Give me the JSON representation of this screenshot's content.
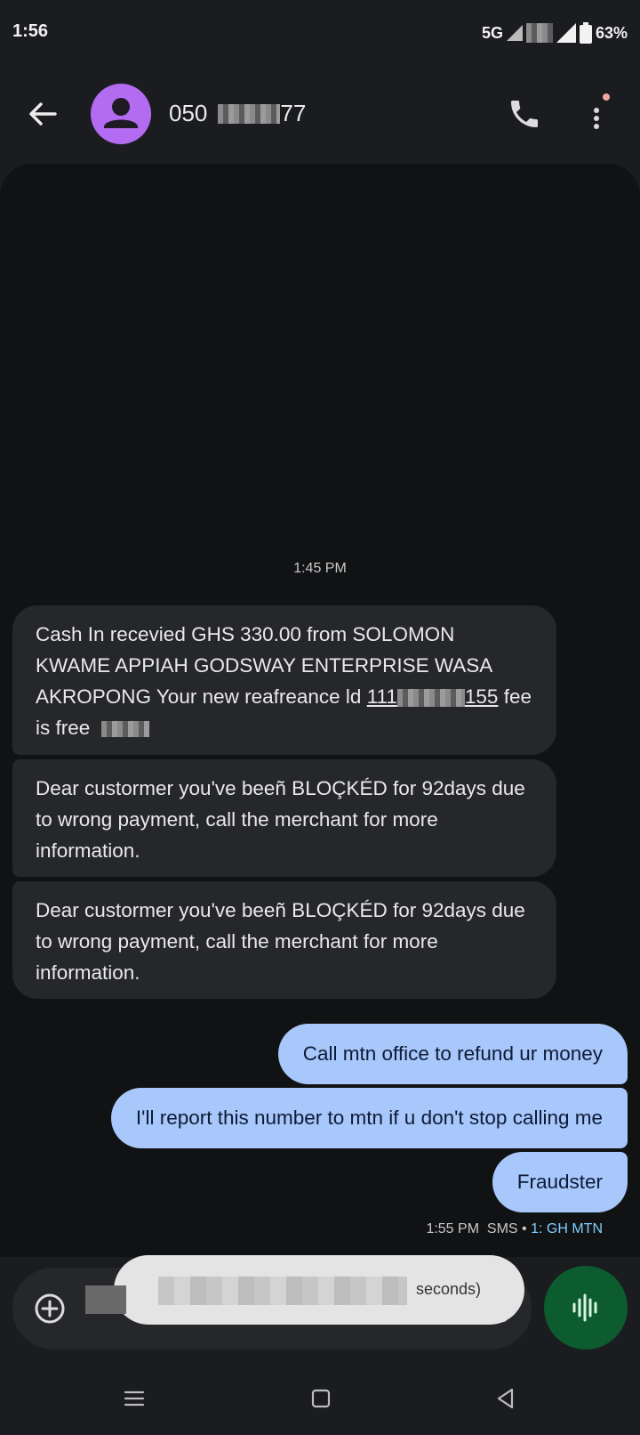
{
  "status_bar": {
    "time": "1:56",
    "network": "5G",
    "battery": "63%"
  },
  "header": {
    "contact_prefix": "050",
    "contact_suffix": "77"
  },
  "conversation": {
    "timestamp": "1:45 PM",
    "incoming": [
      {
        "text_a": "Cash In  recevied GHS 330.00 from SOLOMON KWAME APPIAH GODSWAY ENTERPRISE WASA AKROPONG Your new  reafreance ld ",
        "link_prefix": "111",
        "link_suffix": "155",
        "text_b": " fee is free"
      },
      {
        "text": "Dear custormer you've  beeñ BLOÇKÉD for 92days due to wrong payment, call the merchant for more information."
      },
      {
        "text": "Dear custormer you've  beeñ BLOÇKÉD for 92days due to wrong payment, call the merchant for more information."
      }
    ],
    "outgoing": [
      {
        "text": "Call mtn office to refund ur money"
      },
      {
        "text": "I'll report this number to mtn if u don't stop calling me"
      },
      {
        "text": "Fraudster"
      }
    ],
    "meta": {
      "time": "1:55 PM",
      "type": "SMS",
      "separator": "•",
      "sim": "1: GH MTN"
    }
  },
  "toast": {
    "text_visible": "seconds)"
  },
  "colors": {
    "accent_out": "#a8c7fa",
    "avatar": "#b36cf1",
    "voice_button": "#0c5c2f",
    "sim_label": "#7fcfff"
  },
  "icons": [
    "back-arrow-icon",
    "person-icon",
    "phone-icon",
    "more-vert-icon",
    "add-circle-icon",
    "emoji-icon",
    "gallery-icon",
    "voice-wave-icon",
    "nav-menu-icon",
    "nav-home-icon",
    "nav-back-icon"
  ]
}
